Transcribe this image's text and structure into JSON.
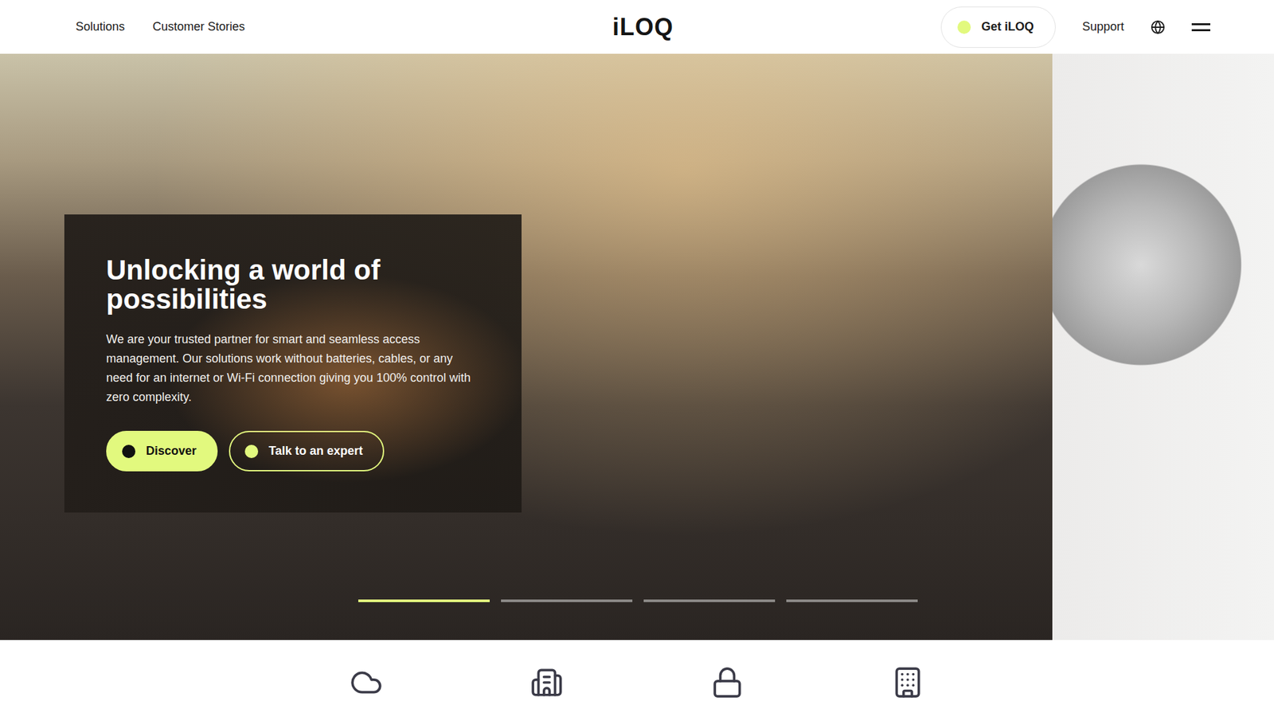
{
  "header": {
    "nav": [
      {
        "label": "Solutions"
      },
      {
        "label": "Customer Stories"
      }
    ],
    "logo": "iLOQ",
    "get_button": "Get iLOQ",
    "support": "Support"
  },
  "hero": {
    "title": "Unlocking a world of possibilities",
    "text": "We are your trusted partner for smart and seamless access management. Our solutions work without batteries, cables, or any need for an internet or Wi-Fi connection giving you 100% control with zero complexity.",
    "buttons": [
      {
        "label": "Discover",
        "kind": "primary"
      },
      {
        "label": "Talk to an expert",
        "kind": "outline"
      }
    ],
    "slides": [
      {
        "selected": true,
        "level": 1
      },
      {
        "selected": false,
        "level": 0
      },
      {
        "selected": false,
        "level": 0
      },
      {
        "selected": false,
        "level": 0
      }
    ]
  }
}
